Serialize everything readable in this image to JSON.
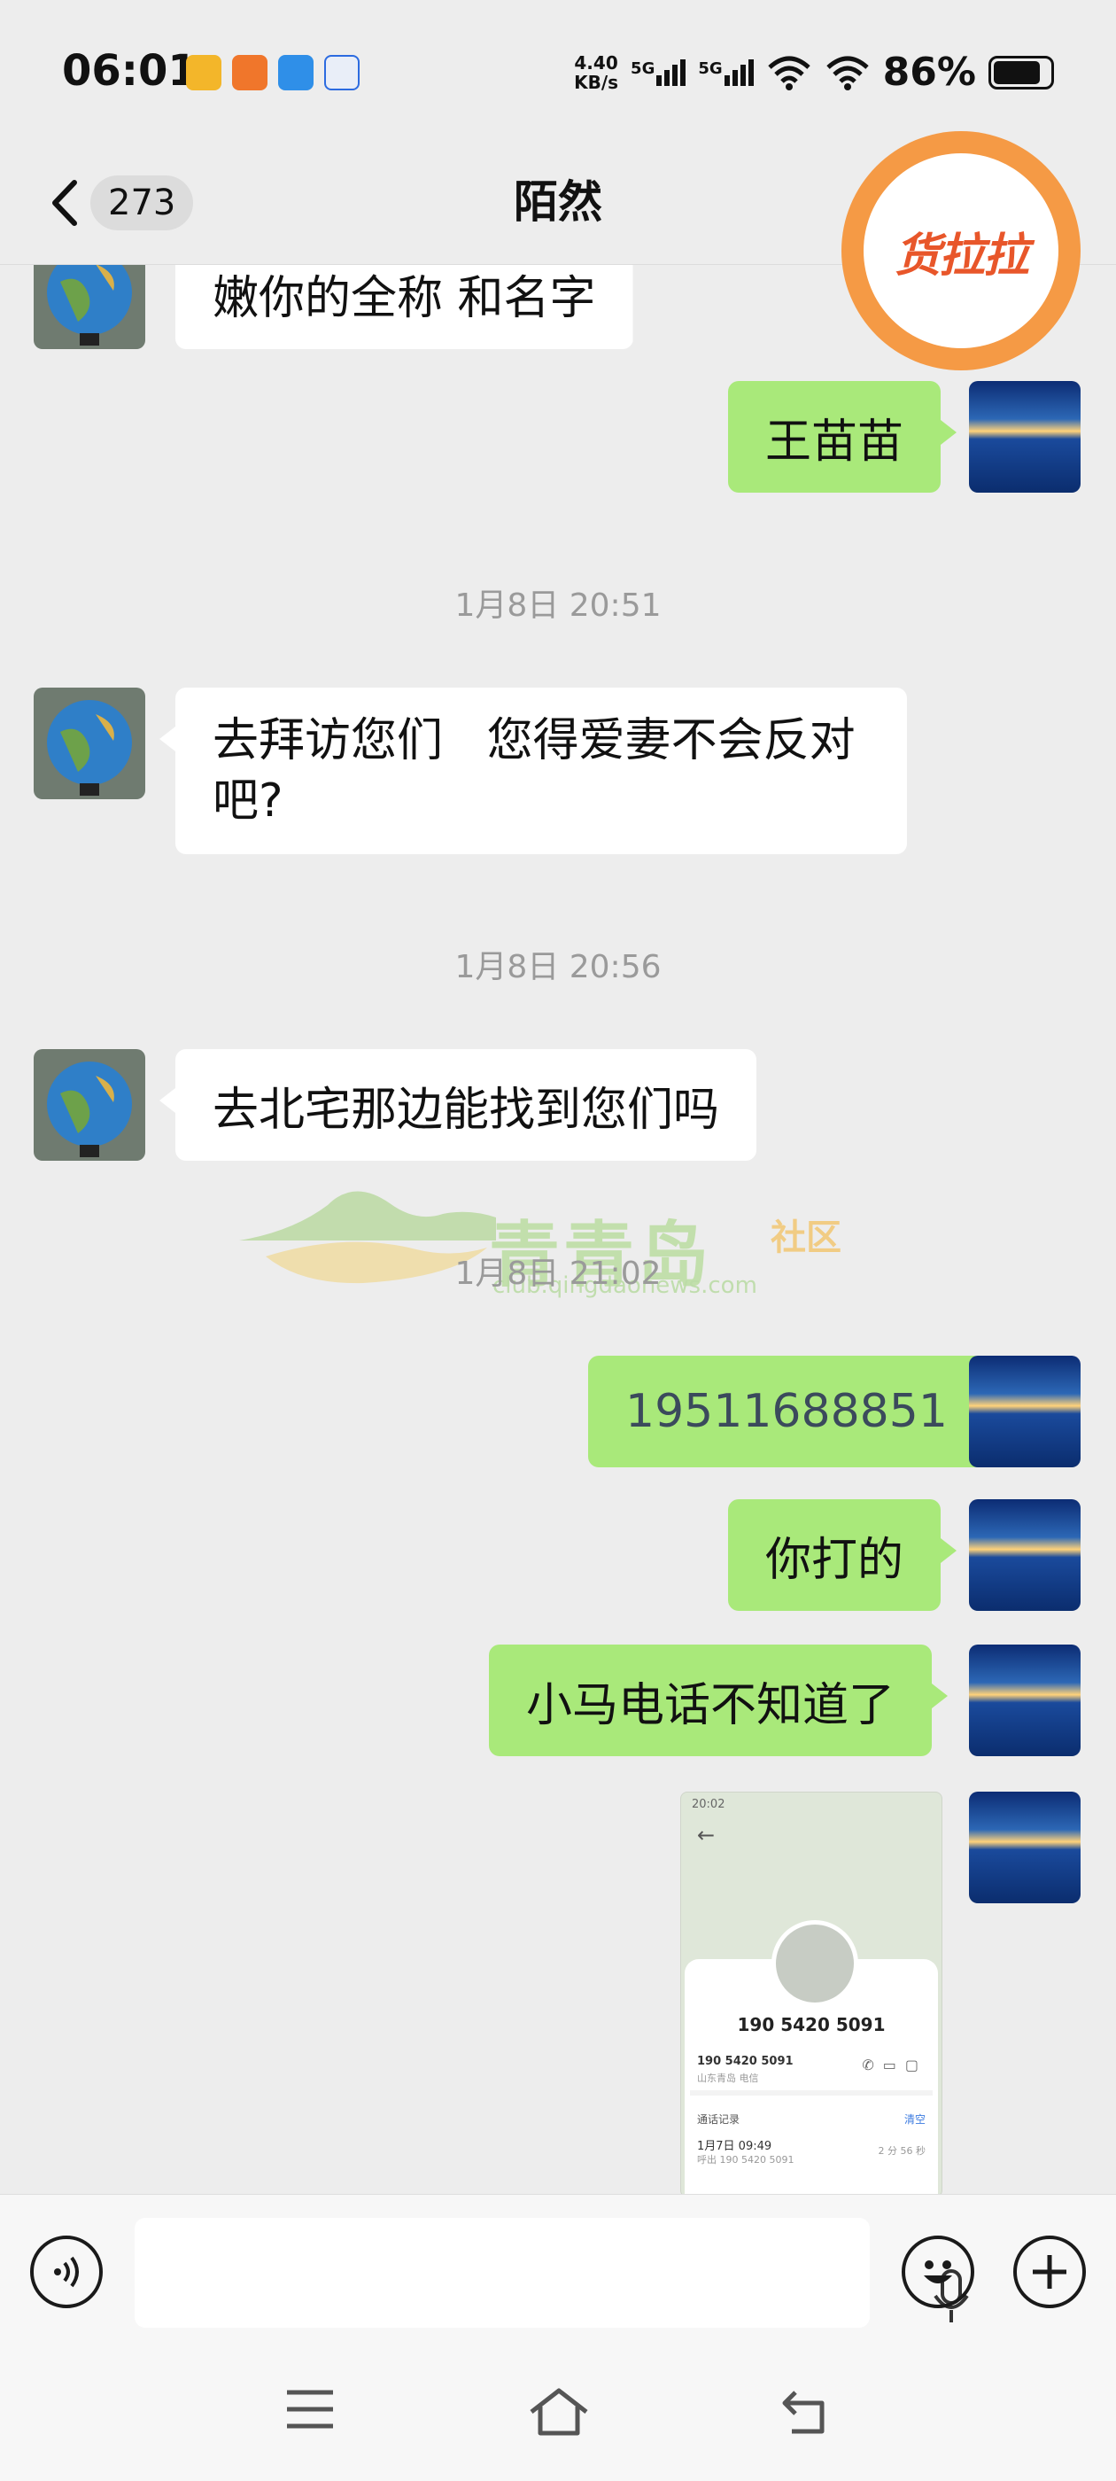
{
  "status_bar": {
    "time": "06:01",
    "net_speed_value": "4.40",
    "net_speed_unit": "KB/s",
    "signal_1": "5G",
    "signal_2": "5G",
    "battery_percent": "86%",
    "battery_level": 0.86,
    "notification_icons": [
      "app-notification-icon-1",
      "app-notification-icon-2",
      "app-notification-icon-3",
      "app-notification-icon-4"
    ]
  },
  "header": {
    "unread_count": "273",
    "chat_title": "陌然"
  },
  "floating_badge": {
    "logo_text": "货拉拉"
  },
  "messages": {
    "m1": "嫩你的全称  和名字",
    "m2": "王苗苗",
    "t1": "1月8日 20:51",
    "m3_line1": "去拜访您们   您得爱妻不会反对",
    "m3_line2": "吧?",
    "t2": "1月8日 20:56",
    "m4": "去北宅那边能找到您们吗",
    "t3": "1月8日 21:02",
    "m5": "19511688851",
    "m6": "你打的",
    "m7": "小马电话不知道了"
  },
  "image_message": {
    "status_time": "20:02",
    "phone_number": "190 5420 5091",
    "line_number": "190 5420 5091",
    "line_location": "山东青岛 电信",
    "call_log_title": "通话记录",
    "clear_label": "清空",
    "log_time": "1月7日 09:49",
    "log_number": "呼出 190 5420 5091",
    "log_duration": "2 分 56 秒"
  },
  "watermark": {
    "brand": "青青岛",
    "suffix": "社区",
    "url": "club.qingdaonews.com"
  },
  "colors": {
    "background": "#ededed",
    "outgoing_bubble": "#a9e97a",
    "incoming_bubble": "#ffffff",
    "timestamp_text": "#9a9a9a",
    "badge_orange": "#f59a45"
  }
}
